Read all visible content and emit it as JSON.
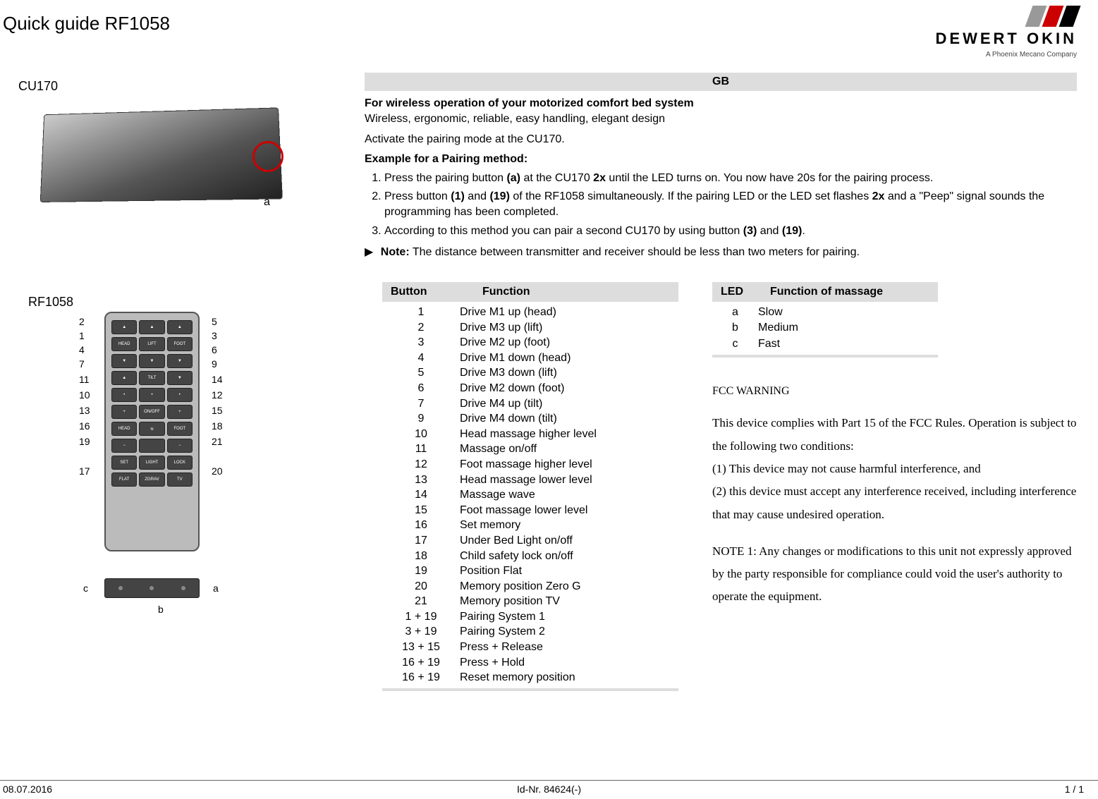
{
  "header": {
    "title": "Quick guide RF1058",
    "logo_text1": "DEWERT OKIN",
    "logo_text2": "A Phoenix Mecano Company"
  },
  "left": {
    "cu170_label": "CU170",
    "cu170_callout_a": "a",
    "rf1058_label": "RF1058",
    "remote_callouts_left": [
      "2",
      "1",
      "4",
      "7",
      "11",
      "10",
      "13",
      "16",
      "19",
      "17"
    ],
    "remote_callouts_right": [
      "5",
      "3",
      "6",
      "9",
      "14",
      "12",
      "15",
      "18",
      "21",
      "20"
    ],
    "remote_row_labels": [
      [
        "▲",
        "▲",
        "▲"
      ],
      [
        "HEAD",
        "LIFT",
        "FOOT"
      ],
      [
        "▼",
        "▼",
        "▼"
      ],
      [
        "▲",
        "TILT",
        "▼"
      ],
      [
        "•",
        "•",
        "•"
      ],
      [
        "+",
        "ON/OFF",
        "+"
      ],
      [
        "HEAD",
        "≋",
        "FOOT"
      ],
      [
        "−",
        "",
        "−"
      ],
      [
        "SET",
        "LIGHT",
        "LOCK"
      ],
      [
        "FLAT",
        "ZGRAV",
        "TV"
      ]
    ],
    "led_labels": {
      "c": "c",
      "b": "b",
      "a": "a"
    }
  },
  "gb": {
    "header": "GB",
    "heading1": "For wireless operation of your motorized comfort bed system",
    "sub1": "Wireless, ergonomic, reliable, easy handling, elegant design",
    "sub2": "Activate the pairing mode at the CU170.",
    "heading2": "Example for a Pairing method:",
    "steps": [
      "Press the pairing button (a) at the CU170 2x until the LED turns on. You now have 20s for the pairing process.",
      "Press button (1) and (19) of the RF1058 simultaneously. If the pairing LED or the LED set flashes 2x and a \"Peep\" signal sounds the programming has been completed.",
      "According to this method you can pair a second CU170 by using button (3) and (19)."
    ],
    "note_label": "Note:",
    "note_text": "The distance between transmitter and receiver should be less than two meters for pairing."
  },
  "button_table": {
    "headers": [
      "Button",
      "Function"
    ],
    "rows": [
      [
        "1",
        "Drive M1 up (head)"
      ],
      [
        "2",
        "Drive M3 up (lift)"
      ],
      [
        "3",
        "Drive M2 up (foot)"
      ],
      [
        "4",
        "Drive M1 down (head)"
      ],
      [
        "5",
        "Drive M3 down (lift)"
      ],
      [
        "6",
        "Drive M2 down (foot)"
      ],
      [
        "7",
        "Drive M4 up (tilt)"
      ],
      [
        "9",
        "Drive M4 down (tilt)"
      ],
      [
        "10",
        "Head massage higher level"
      ],
      [
        "11",
        "Massage on/off"
      ],
      [
        "12",
        "Foot massage higher level"
      ],
      [
        "13",
        "Head massage lower level"
      ],
      [
        "14",
        "Massage wave"
      ],
      [
        "15",
        "Foot massage lower level"
      ],
      [
        "16",
        "Set memory"
      ],
      [
        "17",
        "Under Bed Light on/off"
      ],
      [
        "18",
        "Child safety lock on/off"
      ],
      [
        "19",
        "Position Flat"
      ],
      [
        "20",
        "Memory position Zero G"
      ],
      [
        "21",
        "Memory position TV"
      ],
      [
        "1 + 19",
        "Pairing System 1"
      ],
      [
        "3 + 19",
        "Pairing System 2"
      ],
      [
        "13 + 15",
        "Press + Release"
      ],
      [
        "16 + 19",
        "Press + Hold"
      ],
      [
        "16 + 19",
        "Reset memory position"
      ]
    ]
  },
  "led_table": {
    "headers": [
      "LED",
      "Function of massage"
    ],
    "rows": [
      [
        "a",
        "Slow"
      ],
      [
        "b",
        "Medium"
      ],
      [
        "c",
        "Fast"
      ]
    ]
  },
  "fcc": {
    "heading": "FCC WARNING",
    "p1": "This device complies with Part 15 of the FCC Rules. Operation is subject to the following two conditions:",
    "p2": "(1) This device may not cause harmful interference, and",
    "p3": "(2) this device must accept any interference received, including interference that may cause undesired operation.",
    "p4": "NOTE 1: Any changes or modifications to this unit not expressly approved by the party responsible for compliance could void the user's authority to operate the equipment."
  },
  "footer": {
    "left": "08.07.2016",
    "mid": "Id-Nr. 84624(-)",
    "right": "1 / 1"
  }
}
